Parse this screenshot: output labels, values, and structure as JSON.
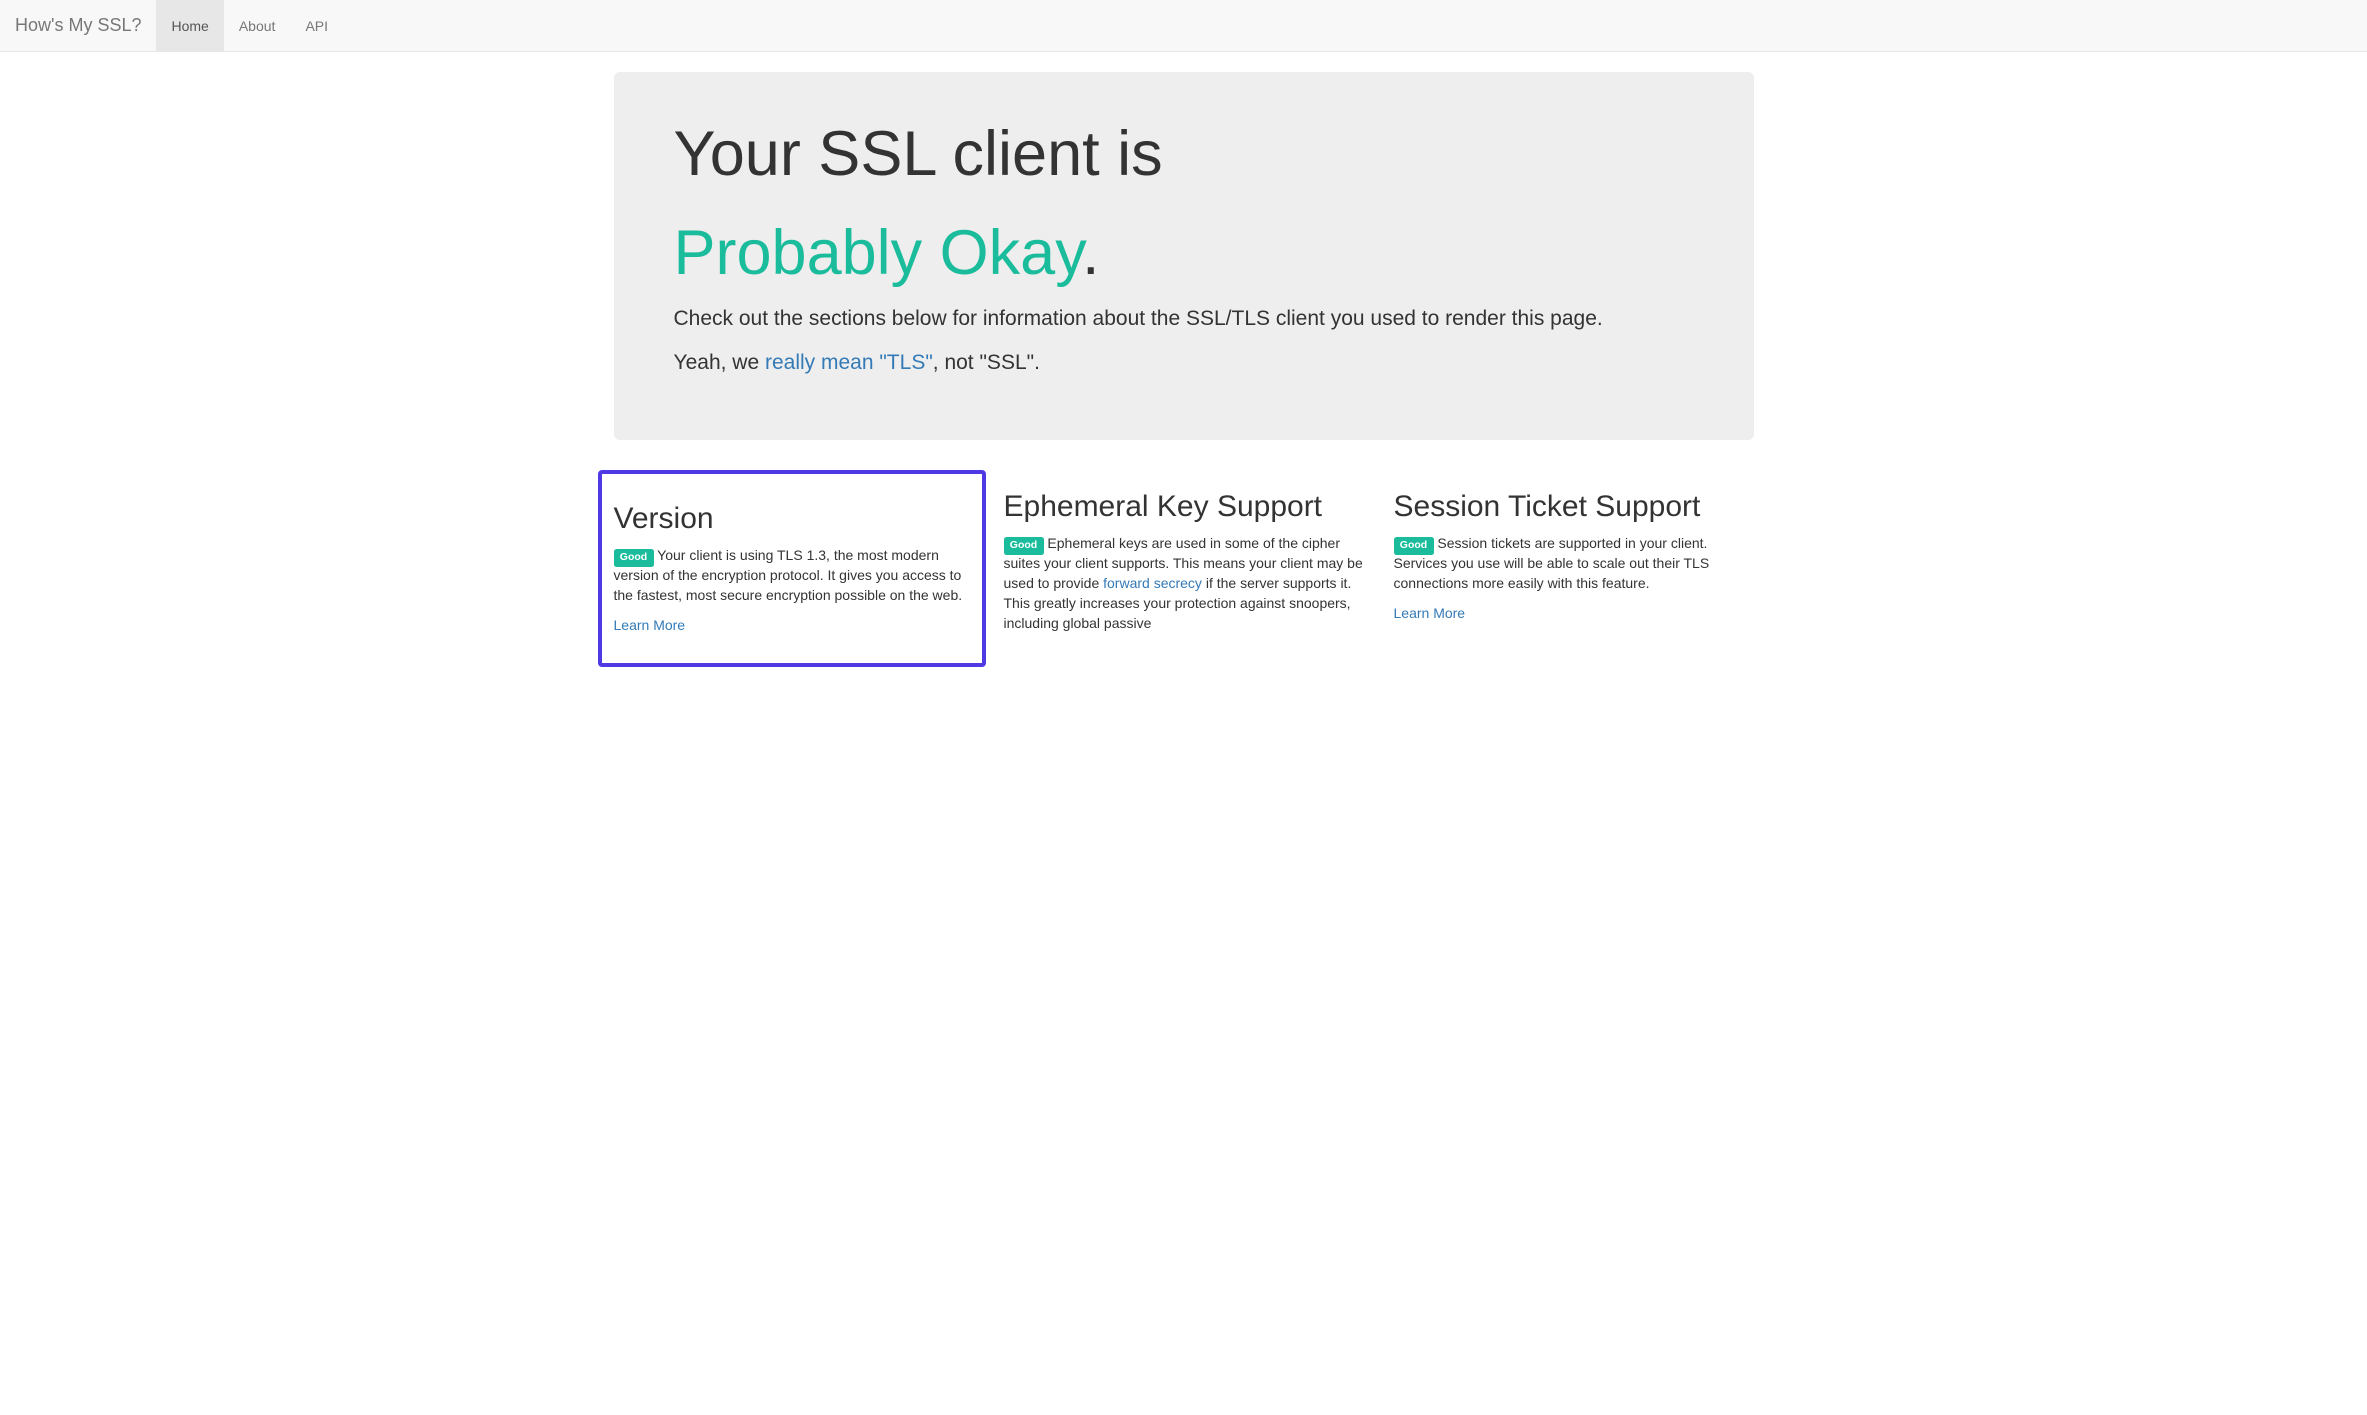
{
  "nav": {
    "brand": "How's My SSL?",
    "items": [
      {
        "label": "Home",
        "active": true
      },
      {
        "label": "About",
        "active": false
      },
      {
        "label": "API",
        "active": false
      }
    ]
  },
  "hero": {
    "title_prefix": "Your SSL client is",
    "rating": "Probably Okay",
    "period": ".",
    "subtext": "Check out the sections below for information about the SSL/TLS client you used to render this page.",
    "tls_prefix": "Yeah, we ",
    "tls_link": "really mean \"TLS\"",
    "tls_suffix": ", not \"SSL\"."
  },
  "sections": {
    "version": {
      "title": "Version",
      "badge": "Good",
      "text": " Your client is using TLS 1.3, the most modern version of the encryption protocol. It gives you access to the fastest, most secure encryption possible on the web.",
      "learn_more": "Learn More"
    },
    "ephemeral": {
      "title": "Ephemeral Key Support",
      "badge": "Good",
      "text_before": " Ephemeral keys are used in some of the cipher suites your client supports. This means your client may be used to provide ",
      "link": "forward secrecy",
      "text_after": " if the server supports it. This greatly increases your protection against snoopers, including global passive"
    },
    "session": {
      "title": "Session Ticket Support",
      "badge": "Good",
      "text": " Session tickets are supported in your client. Services you use will be able to scale out their TLS connections more easily with this feature.",
      "learn_more": "Learn More"
    }
  }
}
